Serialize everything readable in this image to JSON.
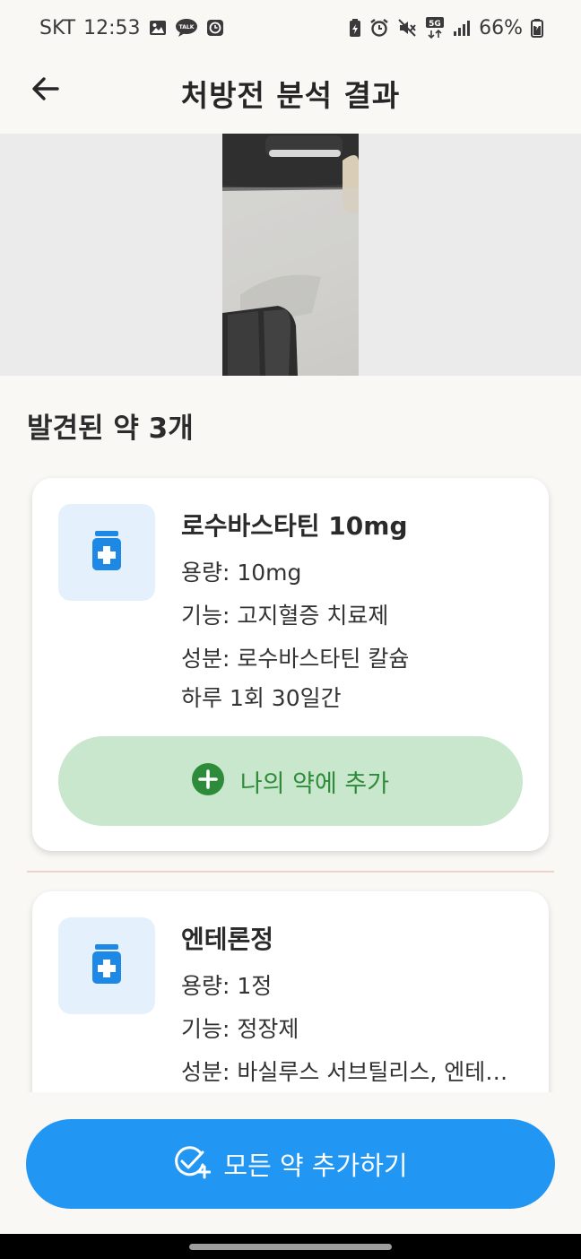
{
  "status_bar": {
    "carrier": "SKT",
    "time": "12:53",
    "network": "5G",
    "battery": "66%",
    "left_icons": [
      "gallery-icon",
      "talk-icon",
      "clock-app-icon"
    ],
    "right_icons": [
      "battery-saver-icon",
      "alarm-icon",
      "mute-icon",
      "5g-icon",
      "signal-icon",
      "battery-icon"
    ]
  },
  "header": {
    "title": "처방전 분석 결과",
    "back_icon": "arrow-left-icon"
  },
  "results": {
    "heading": "발견된 약 3개",
    "medicines": [
      {
        "name": "로수바스타틴 10mg",
        "dosage": "용량: 10mg",
        "function": "기능: 고지혈증 치료제",
        "ingredient": "성분: 로수바스타틴 칼슘",
        "schedule": "하루 1회  30일간",
        "add_label": "나의 약에 추가",
        "icon": "medicine-bottle-icon"
      },
      {
        "name": "엔테론정",
        "dosage": "용량: 1정",
        "function": "기능: 정장제",
        "ingredient": "성분: 바실루스 서브틸리스, 엔테…",
        "icon": "medicine-bottle-icon"
      }
    ]
  },
  "footer": {
    "add_all_label": "모든 약 추가하기",
    "add_all_icon": "check-plus-icon"
  },
  "colors": {
    "background": "#f9f8f4",
    "primary": "#2196f3",
    "add_button_bg": "#c9e7cc",
    "add_button_text": "#2e8b3a",
    "icon_bg": "#e4f1fd"
  }
}
